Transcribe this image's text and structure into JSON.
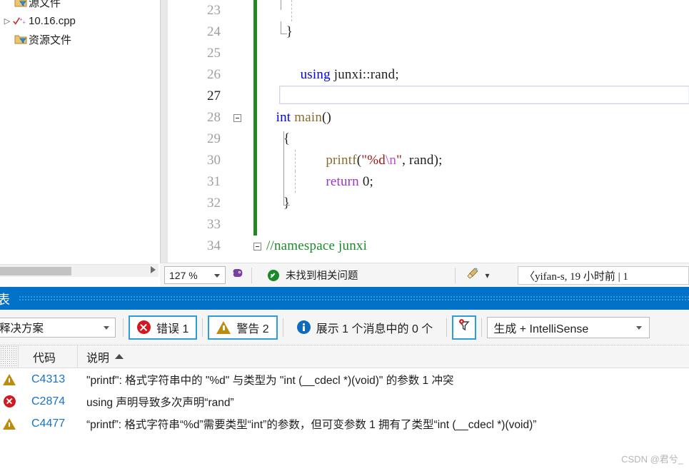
{
  "solution_explorer": {
    "items": [
      {
        "label": "源文件",
        "icon": "folder-filter-icon",
        "indent": 1,
        "expander": "",
        "kind": "folder"
      },
      {
        "label": "10.16.cpp",
        "icon": "cpp-file-icon",
        "indent": 2,
        "expander": "▷",
        "kind": "file"
      },
      {
        "label": "资源文件",
        "icon": "folder-filter-icon",
        "indent": 1,
        "expander": "",
        "kind": "folder"
      }
    ],
    "hscrollbar": {
      "name": "horizontal-scrollbar",
      "right_arrow": "▶"
    }
  },
  "editor": {
    "lines": [
      {
        "num": "23",
        "fold": false,
        "changebar": true,
        "indent": 0,
        "tokens": []
      },
      {
        "num": "24",
        "fold": false,
        "changebar": true,
        "indent": 0,
        "tokens": [
          {
            "t": "    }",
            "c": ""
          }
        ]
      },
      {
        "num": "25",
        "fold": false,
        "changebar": true,
        "indent": 0,
        "tokens": []
      },
      {
        "num": "26",
        "fold": false,
        "changebar": true,
        "indent": 0,
        "tokens": [
          {
            "t": "  ",
            "c": ""
          },
          {
            "t": "using",
            "c": "kw"
          },
          {
            "t": " junxi::rand;",
            "c": ""
          }
        ]
      },
      {
        "num": "27",
        "fold": false,
        "changebar": true,
        "indent": 0,
        "tokens": []
      },
      {
        "num": "28",
        "fold": true,
        "changebar": true,
        "indent": 0,
        "tokens": [
          {
            "t": "int",
            "c": "kw"
          },
          {
            "t": " ",
            "c": ""
          },
          {
            "t": "main",
            "c": "fn"
          },
          {
            "t": "()",
            "c": ""
          }
        ]
      },
      {
        "num": "29",
        "fold": false,
        "changebar": true,
        "indent": 0,
        "tokens": [
          {
            "t": "  {",
            "c": ""
          }
        ]
      },
      {
        "num": "30",
        "fold": false,
        "changebar": true,
        "indent": 0,
        "tokens": [
          {
            "t": "      ",
            "c": ""
          },
          {
            "t": "printf",
            "c": "fn"
          },
          {
            "t": "(",
            "c": ""
          },
          {
            "t": "\"%d",
            "c": "str"
          },
          {
            "t": "\\n",
            "c": "esc"
          },
          {
            "t": "\"",
            "c": "str"
          },
          {
            "t": ", rand);",
            "c": ""
          }
        ]
      },
      {
        "num": "31",
        "fold": false,
        "changebar": true,
        "indent": 0,
        "tokens": [
          {
            "t": "      ",
            "c": ""
          },
          {
            "t": "return",
            "c": "ctl"
          },
          {
            "t": " 0;",
            "c": ""
          }
        ]
      },
      {
        "num": "32",
        "fold": false,
        "changebar": true,
        "indent": 0,
        "tokens": [
          {
            "t": "  }",
            "c": ""
          }
        ]
      },
      {
        "num": "33",
        "fold": false,
        "changebar": true,
        "indent": 0,
        "tokens": []
      },
      {
        "num": "34",
        "fold": true,
        "changebar": false,
        "indent": 0,
        "tokens": [
          {
            "t": "//namespace junxi",
            "c": "cmt"
          }
        ]
      }
    ],
    "cursor_line": "27",
    "colors": {
      "keyword": "#0000ff",
      "function": "#8a6a2f",
      "string": "#a31515",
      "escape": "#c04bd0",
      "comment": "#1a8a26",
      "control": "#9a33c6",
      "changebar": "#1f8a1f",
      "line_number": "#a0a0a0"
    }
  },
  "editor_status": {
    "zoom_value": "127 %",
    "intellisense_icon": "brain-icon",
    "issue_status": "未找到相关问题",
    "issue_status_icon": "check-circle-icon",
    "cleanup_icon": "broom-icon",
    "cleanup_caret": "▾",
    "codelens": "〈yifan-s, 19 小时前 | 1"
  },
  "error_list": {
    "title": "表",
    "title_bar_color": "#0172c8",
    "toolbar": {
      "scope_value": "释决方案",
      "errors_label": "错误 1",
      "errors_selected": true,
      "warnings_label": "警告 2",
      "warnings_selected": true,
      "messages_label": "展示 1 个消息中的 0 个",
      "messages_selected": false,
      "filter_icon": "filter-pin-icon",
      "filter_selected": true,
      "build_value": "生成 + IntelliSense"
    },
    "columns": [
      {
        "label": "代码"
      },
      {
        "label": "说明",
        "sort": "asc"
      }
    ],
    "rows": [
      {
        "severity": "warning",
        "code": "C4313",
        "description": "\"printf\": 格式字符串中的 \"%d\" 与类型为 \"int (__cdecl *)(void)\" 的参数 1 冲突"
      },
      {
        "severity": "error",
        "code": "C2874",
        "description": "using 声明导致多次声明“rand”"
      },
      {
        "severity": "warning",
        "code": "C4477",
        "description": "“printf”: 格式字符串“%d”需要类型“int”的参数，但可变参数 1 拥有了类型“int (__cdecl *)(void)”"
      }
    ]
  },
  "watermark": "CSDN @君兮_"
}
